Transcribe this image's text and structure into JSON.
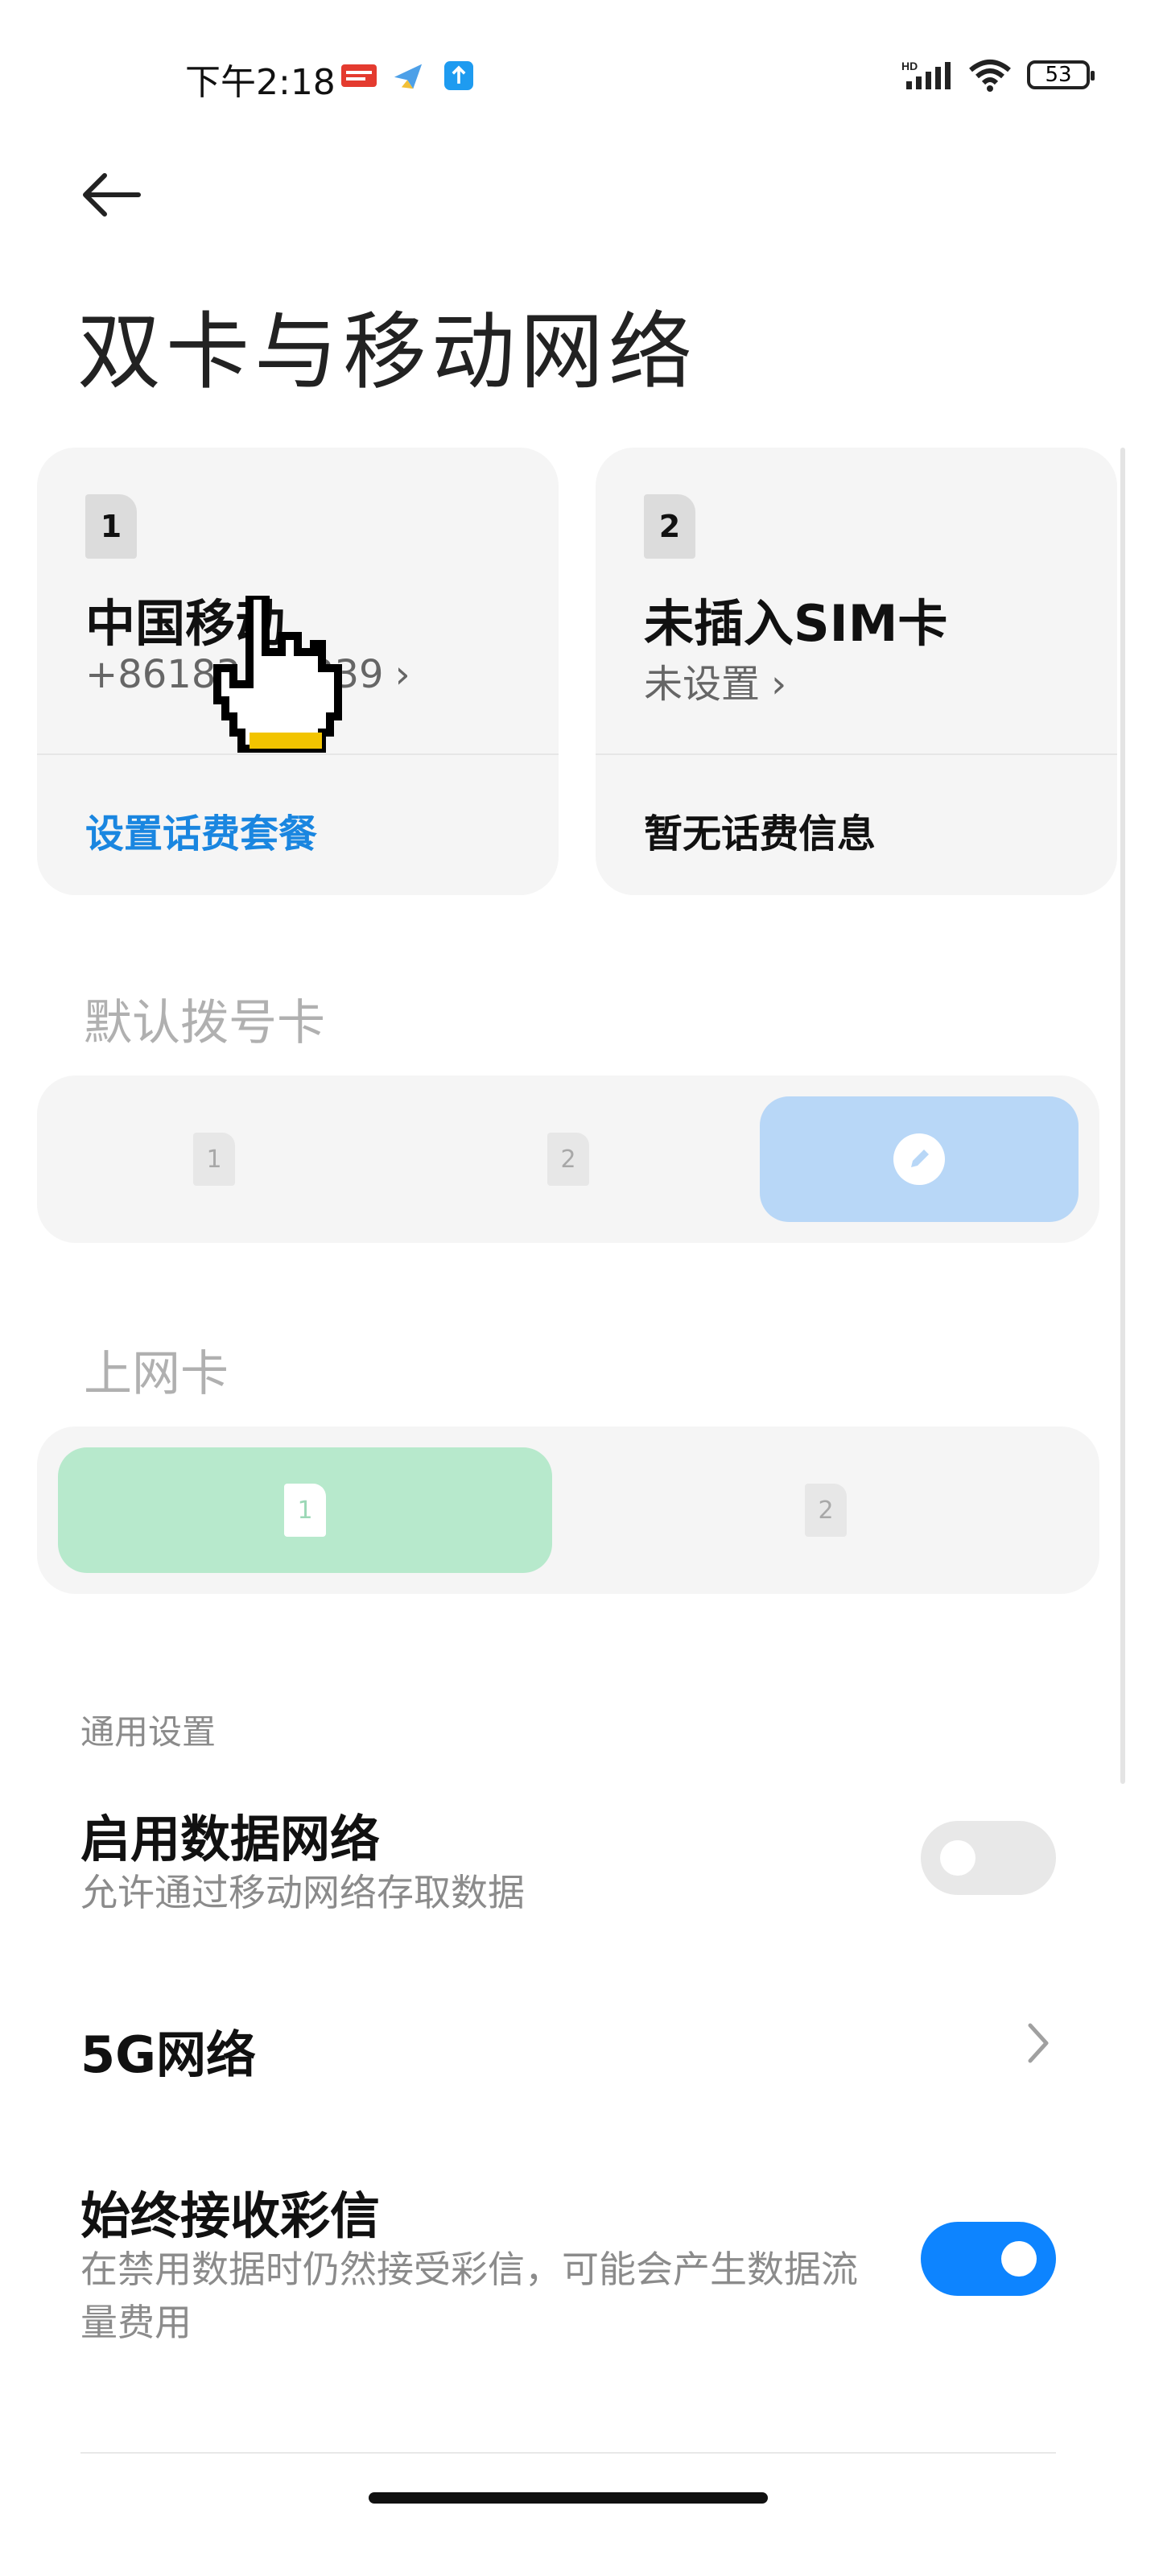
{
  "status_bar": {
    "time": "下午2:18",
    "notification_icons": [
      "toutiao-icon",
      "plane-app-icon",
      "upload-app-icon"
    ],
    "network_label": "HD",
    "battery": "53"
  },
  "header": {
    "title": "双卡与移动网络"
  },
  "sim_cards": [
    {
      "slot": "1",
      "name": "中国移动",
      "number": "+86183",
      "number_suffix": "339",
      "action": "设置话费套餐",
      "action_color": "#1a86e0"
    },
    {
      "slot": "2",
      "name": "未插入SIM卡",
      "number": "未设置",
      "number_suffix": "",
      "action": "暂无话费信息",
      "action_color": "#111111"
    }
  ],
  "default_dial": {
    "title": "默认拨号卡",
    "options": [
      "1",
      "2"
    ],
    "selected": "ask-each-time",
    "selected_color": "#b8d7f7"
  },
  "data_sim": {
    "title": "上网卡",
    "options": [
      "1",
      "2"
    ],
    "selected": "1",
    "selected_color": "#b7e9cc"
  },
  "general": {
    "label": "通用设置",
    "enable_data": {
      "title": "启用数据网络",
      "subtitle": "允许通过移动网络存取数据",
      "on": false
    },
    "fiveg": {
      "title": "5G网络"
    },
    "mms": {
      "title": "始终接收彩信",
      "subtitle": "在禁用数据时仍然接受彩信，可能会产生数据流量费用",
      "on": true
    }
  },
  "colors": {
    "accent": "#0d84ff",
    "link": "#1a86e0"
  }
}
